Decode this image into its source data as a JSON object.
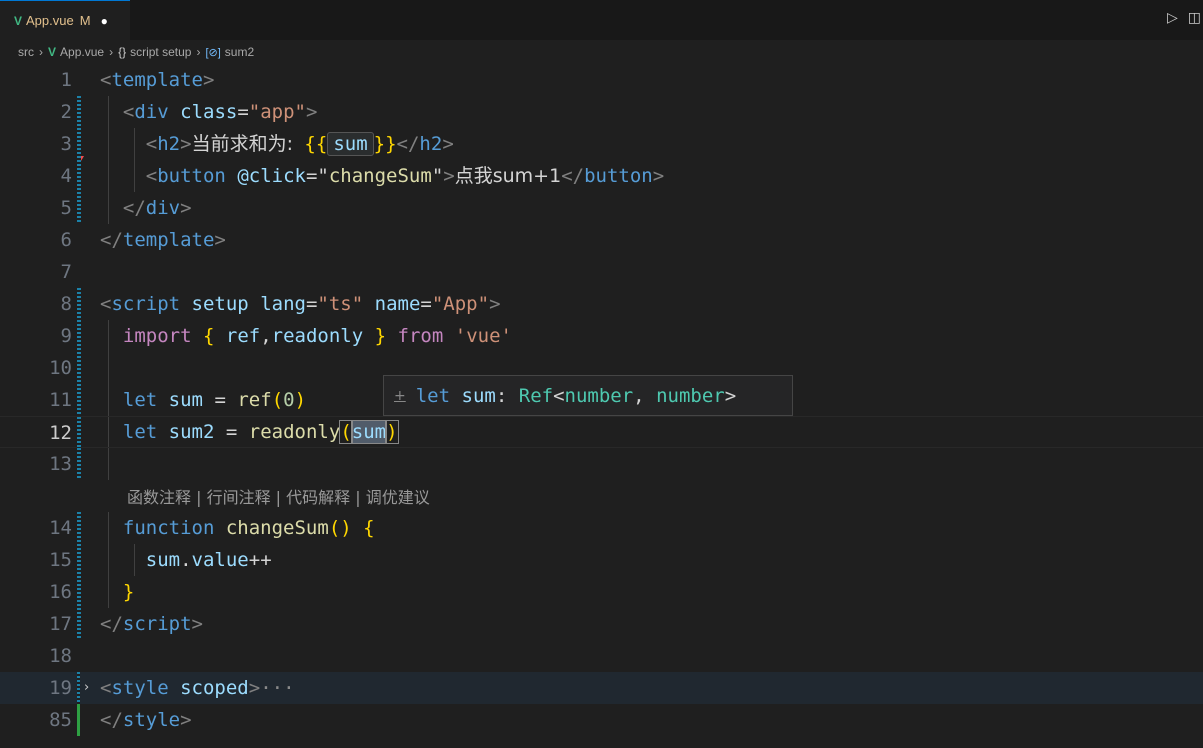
{
  "tab": {
    "icon": "vue-logo-icon",
    "filename": "App.vue",
    "status": "M",
    "unsaved": "●"
  },
  "tab_actions": {
    "run": "▷",
    "split": "◫"
  },
  "breadcrumb": {
    "folder": "src",
    "file": "App.vue",
    "scope": "script setup",
    "symbol": "sum2"
  },
  "editor": {
    "current_line": 12,
    "line_numbers": [
      "1",
      "2",
      "3",
      "4",
      "5",
      "6",
      "7",
      "8",
      "9",
      "10",
      "11",
      "12",
      "13",
      "14",
      "15",
      "16",
      "17",
      "18",
      "19",
      "85"
    ],
    "codelens": "函数注释 | 行间注释 | 代码解释 | 调优建议",
    "hover": {
      "plus": "+",
      "text": "let sum: Ref<number, number>"
    }
  },
  "colors": {
    "accent": "#0078d4",
    "vue": "#41b883",
    "modified": "#e2c08d",
    "background": "#1f1f1f"
  }
}
